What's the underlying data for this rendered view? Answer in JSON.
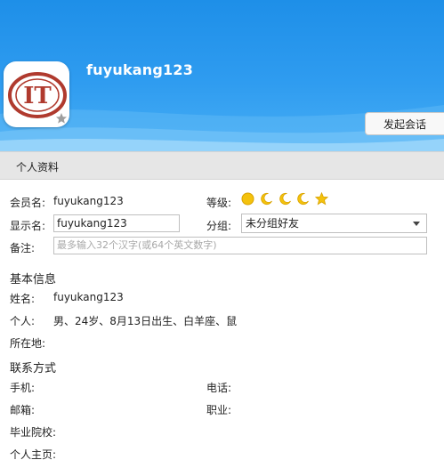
{
  "header": {
    "username": "fuyukang123",
    "chat_button": "发起会话"
  },
  "section": {
    "title": "个人资料"
  },
  "account": {
    "member_label": "会员名:",
    "member_value": "fuyukang123",
    "level_label": "等级:",
    "level_icons": [
      "sun-icon",
      "moon-icon",
      "moon-icon",
      "moon-icon",
      "star-icon"
    ],
    "display_label": "显示名:",
    "display_value": "fuyukang123",
    "group_label": "分组:",
    "group_value": "未分组好友",
    "note_label": "备注:",
    "note_placeholder": "最多输入32个汉字(或64个英文数字)"
  },
  "basic": {
    "heading": "基本信息",
    "name_label": "姓名:",
    "name_value": "fuyukang123",
    "personal_label": "个人:",
    "personal_value": "男、24岁、8月13日出生、白羊座、鼠",
    "location_label": "所在地:"
  },
  "contact": {
    "heading": "联系方式",
    "phone_label": "手机:",
    "tel_label": "电话:",
    "email_label": "邮箱:",
    "job_label": "职业:",
    "school_label": "毕业院校:",
    "homepage_label": "个人主页:"
  },
  "colors": {
    "header_blue": "#2f9cf0",
    "level_gold": "#f4c20d",
    "bar_gray": "#e6e6e6"
  }
}
